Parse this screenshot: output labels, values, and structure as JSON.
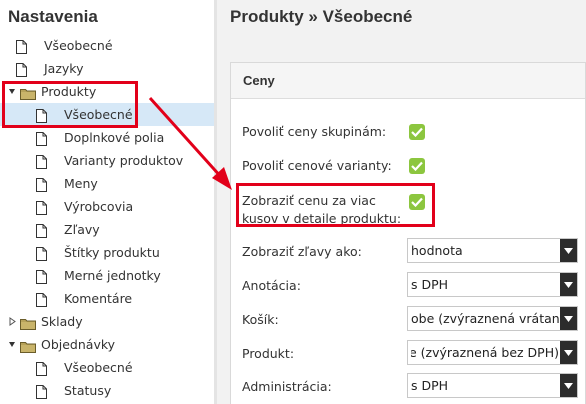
{
  "sidebar": {
    "title": "Nastavenia",
    "items": [
      {
        "label": "Všeobecné",
        "kind": "doc",
        "level": 1
      },
      {
        "label": "Jazyky",
        "kind": "doc",
        "level": 1
      },
      {
        "label": "Produkty",
        "kind": "folder",
        "level": 0,
        "state": "expanded"
      },
      {
        "label": "Všeobecné",
        "kind": "doc",
        "level": 2,
        "selected": true
      },
      {
        "label": "Doplnkové polia",
        "kind": "doc",
        "level": 2
      },
      {
        "label": "Varianty produktov",
        "kind": "doc",
        "level": 2
      },
      {
        "label": "Meny",
        "kind": "doc",
        "level": 2
      },
      {
        "label": "Výrobcovia",
        "kind": "doc",
        "level": 2
      },
      {
        "label": "Zľavy",
        "kind": "doc",
        "level": 2
      },
      {
        "label": "Štítky produktu",
        "kind": "doc",
        "level": 2
      },
      {
        "label": "Merné jednotky",
        "kind": "doc",
        "level": 2
      },
      {
        "label": "Komentáre",
        "kind": "doc",
        "level": 2
      },
      {
        "label": "Sklady",
        "kind": "folder",
        "level": 0,
        "state": "collapsed"
      },
      {
        "label": "Objednávky",
        "kind": "folder",
        "level": 0,
        "state": "expanded"
      },
      {
        "label": "Všeobecné",
        "kind": "doc",
        "level": 2
      },
      {
        "label": "Statusy",
        "kind": "doc",
        "level": 2
      }
    ]
  },
  "main": {
    "title": "Produkty » Všeobecné",
    "panel": {
      "title": "Ceny",
      "checkboxes": [
        {
          "label": "Povoliť ceny skupinám:",
          "checked": true
        },
        {
          "label": "Povoliť cenové varianty:",
          "checked": true
        },
        {
          "label": "Zobraziť cenu za viac kusov v detaile produktu:",
          "checked": true
        }
      ],
      "selects": [
        {
          "label": "Zobraziť zľavy ako:",
          "value": "hodnota"
        },
        {
          "label": "Anotácia:",
          "value": "s DPH"
        },
        {
          "label": "Košík:",
          "value": "obe (zvýraznená vrátane"
        },
        {
          "label": "Produkt:",
          "value": "obe (zvýraznená bez DPH)"
        },
        {
          "label": "Administrácia:",
          "value": "s DPH"
        }
      ]
    }
  },
  "colors": {
    "check_green": "#8cc63f",
    "selected_row": "#d6e8f7",
    "annotation_red": "#e2001a",
    "select_arrow": "#2c2c2c"
  }
}
